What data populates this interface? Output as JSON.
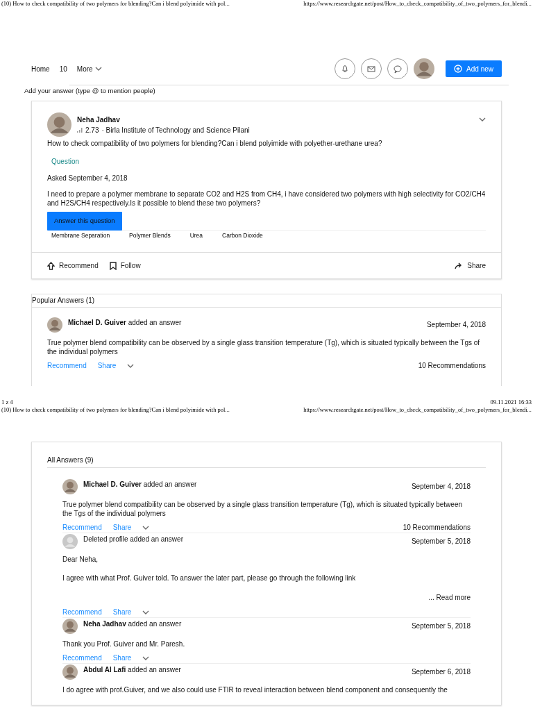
{
  "print_header": {
    "title": "(10) How to check compatibility of two polymers for blending?Can i blend polyimide with pol...",
    "url": "https://www.researchgate.net/post/How_to_check_compatibility_of_two_polymers_for_blendi..."
  },
  "nav": {
    "items": [
      {
        "label": "Home"
      },
      {
        "label": "10"
      },
      {
        "label": "More"
      }
    ],
    "add_button": "Add new"
  },
  "answer_prompt": "Add your answer (type @ to mention people)",
  "question": {
    "author": "Neha Jadhav",
    "score": "2.73",
    "affiliation": "· Birla Institute of Technology and Science Pilani",
    "title": "How to check compatibility of two polymers for blending?Can i blend polyimide with polyether-urethane urea?",
    "type_label": "Question",
    "asked": "Asked September 4, 2018",
    "body": "I need to prepare a polymer membrane to separate CO2 and H2S from CH4, i have considered two polymers with high selectivity for CO2/CH4 and H2S/CH4 ",
    "body_link": "respectively.Is",
    "body_end": " it possible to blend these two polymers?",
    "answer_button": "Answer this question",
    "topics": [
      "Membrane Separation",
      "Polymer Blends",
      "Urea",
      "Carbon Dioxide"
    ],
    "actions": {
      "recommend": "Recommend",
      "follow": "Follow",
      "share": "Share"
    }
  },
  "popular": {
    "heading": "Popular Answers (1)",
    "answers": [
      {
        "author": "Michael D. Guiver",
        "author_bold": true,
        "action": "added an answer",
        "date": "September 4, 2018",
        "paragraphs": [
          "True polymer blend compatibility can be observed by a single glass transition temperature (Tg), which is situated typically between the Tgs of the individual polymers"
        ],
        "recommend": "Recommend",
        "share": "Share",
        "recommendations": "10 Recommendations"
      }
    ]
  },
  "print_footer": {
    "page": "1 z 4",
    "datetime": "09.11.2021 16:33"
  },
  "print_header_2": {
    "title": "(10) How to check compatibility of two polymers for blending?Can i blend polyimide with pol...",
    "url": "https://www.researchgate.net/post/How_to_check_compatibility_of_two_polymers_for_blendi..."
  },
  "all": {
    "heading": "All Answers (9)",
    "answers": [
      {
        "author": "Michael D. Guiver",
        "author_bold": true,
        "action": "added an answer",
        "date": "September 4, 2018",
        "paragraphs": [
          "True polymer blend compatibility can be observed by a single glass transition temperature (Tg), which is situated typically between the Tgs of the individual polymers"
        ],
        "recommend": "Recommend",
        "share": "Share",
        "recommendations": "10 Recommendations"
      },
      {
        "author": "Deleted profile",
        "author_bold": false,
        "action": "added an answer",
        "date": "September 5, 2018",
        "paragraphs": [
          "Dear Neha,",
          "I agree with what Prof. Guiver told. To answer the later part, please go through the following link"
        ],
        "read_more_prefix": "...",
        "read_more": "Read more",
        "recommend": "Recommend",
        "share": "Share"
      },
      {
        "author": "Neha Jadhav",
        "author_bold": true,
        "action": "added an answer",
        "date": "September 5, 2018",
        "paragraphs": [
          "Thank you Prof. Guiver and Mr. Paresh."
        ],
        "recommend": "Recommend",
        "share": "Share"
      },
      {
        "author": "Abdul Al Lafi",
        "author_bold": true,
        "action": "added an answer",
        "date": "September 6, 2018",
        "paragraphs": [
          "I do agree with prof.Guiver, and we also could use FTIR to reveal interaction between blend component and consequently the"
        ]
      }
    ]
  }
}
